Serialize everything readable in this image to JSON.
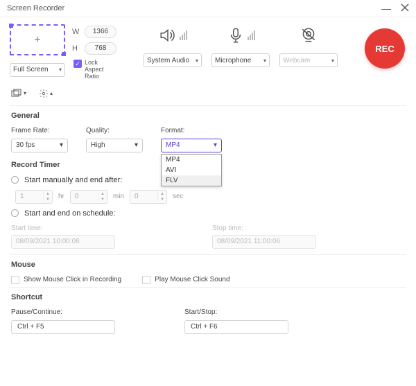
{
  "window": {
    "title": "Screen Recorder"
  },
  "capture": {
    "width": "1366",
    "height": "768",
    "mode": "Full Screen",
    "lock_label": "Lock Aspect Ratio",
    "plus": "+",
    "w_label": "W",
    "h_label": "H"
  },
  "sources": {
    "audio": {
      "label": "System Audio"
    },
    "mic": {
      "label": "Microphone"
    },
    "webcam": {
      "label": "Webcam"
    }
  },
  "rec_label": "REC",
  "general": {
    "title": "General",
    "frame_rate_label": "Frame Rate:",
    "frame_rate_value": "30 fps",
    "quality_label": "Quality:",
    "quality_value": "High",
    "format_label": "Format:",
    "format_value": "MP4",
    "format_options": [
      "MP4",
      "AVI",
      "FLV"
    ]
  },
  "record_timer": {
    "title": "Record Timer",
    "manual_label": "Start manually and end after:",
    "hr_val": "1",
    "hr_unit": "hr",
    "min_val": "0",
    "min_unit": "min",
    "sec_val": "0",
    "sec_unit": "sec",
    "schedule_label": "Start and end on schedule:",
    "start_label": "Start time:",
    "start_value": "08/09/2021 10:00:06",
    "stop_label": "Stop time:",
    "stop_value": "08/09/2021 11:00:06"
  },
  "mouse": {
    "title": "Mouse",
    "show_click": "Show Mouse Click in Recording",
    "play_sound": "Play Mouse Click Sound"
  },
  "shortcut": {
    "title": "Shortcut",
    "pause_label": "Pause/Continue:",
    "pause_value": "Ctrl + F5",
    "start_label": "Start/Stop:",
    "start_value": "Ctrl + F6"
  }
}
